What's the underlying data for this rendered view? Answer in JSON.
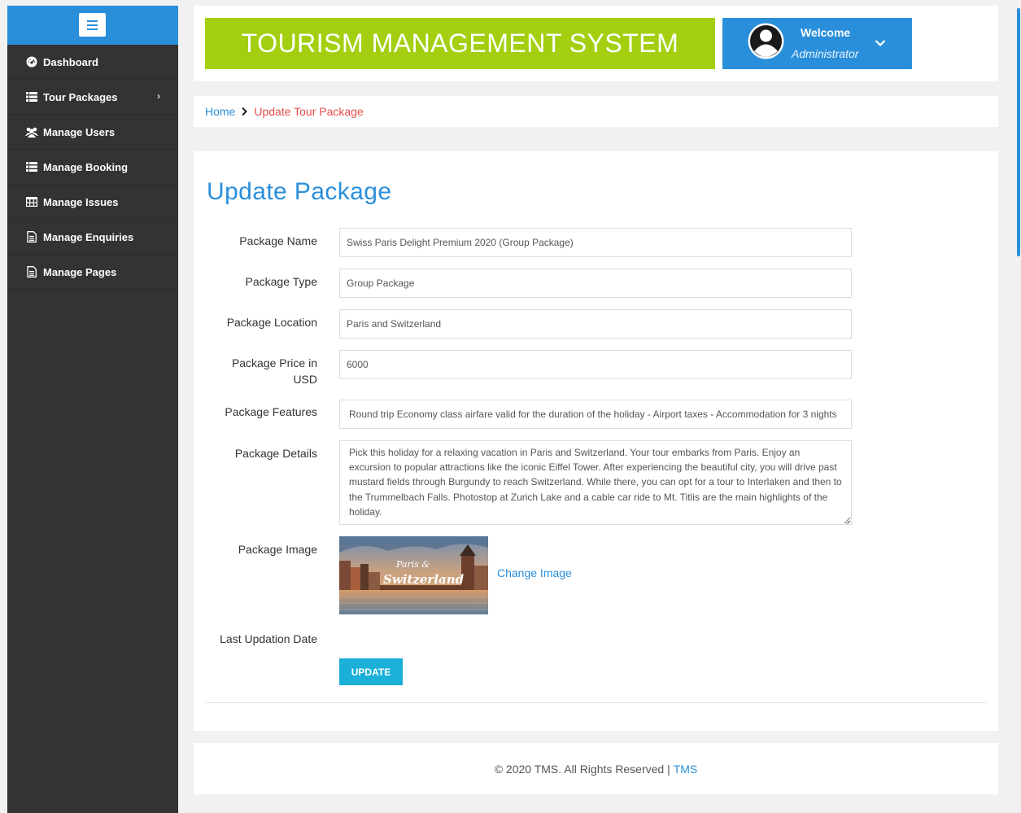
{
  "sidebar": {
    "items": [
      {
        "label": "Dashboard",
        "icon": "dashboard-icon"
      },
      {
        "label": "Tour Packages",
        "icon": "list-icon",
        "has_submenu": true
      },
      {
        "label": "Manage Users",
        "icon": "users-icon"
      },
      {
        "label": "Manage Booking",
        "icon": "list-icon"
      },
      {
        "label": "Manage Issues",
        "icon": "table-icon"
      },
      {
        "label": "Manage Enquiries",
        "icon": "file-icon"
      },
      {
        "label": "Manage Pages",
        "icon": "file-icon"
      }
    ]
  },
  "header": {
    "title": "TOURISM MANAGEMENT SYSTEM",
    "welcome": "Welcome",
    "role": "Administrator"
  },
  "breadcrumb": {
    "home": "Home",
    "current": "Update Tour Package"
  },
  "form": {
    "title": "Update Package",
    "name_label": "Package Name",
    "name_value": "Swiss Paris Delight Premium 2020 (Group Package)",
    "type_label": "Package Type",
    "type_value": "Group Package",
    "location_label": "Package Location",
    "location_value": "Paris and Switzerland",
    "price_label": "Package Price in USD",
    "price_value": "6000",
    "features_label": "Package Features",
    "features_value": "Round trip Economy class airfare valid for the duration of the holiday - Airport taxes - Accommodation for 3 nights",
    "details_label": "Package Details",
    "details_value": "Pick this holiday for a relaxing vacation in Paris and Switzerland. Your tour embarks from Paris. Enjoy an excursion to popular attractions like the iconic Eiffel Tower. After experiencing the beautiful city, you will drive past mustard fields through Burgundy to reach Switzerland. While there, you can opt for a tour to Interlaken and then to the Trummelbach Falls. Photostop at Zurich Lake and a cable car ride to Mt. Titlis are the main highlights of the holiday.",
    "image_label": "Package Image",
    "image_caption_line1": "Paris &",
    "image_caption_line2": "Switzerland",
    "change_image": "Change Image",
    "last_updation_label": "Last Updation Date",
    "update_button": "UPDATE"
  },
  "footer": {
    "text": "© 2020 TMS. All Rights Reserved |",
    "link": "TMS"
  },
  "colors": {
    "accent_blue": "#2a8fdb",
    "logo_green": "#a3cf10",
    "sidebar_bg": "#333333",
    "button_cyan": "#1ab0d8",
    "breadcrumb_current": "#e64d4d"
  }
}
